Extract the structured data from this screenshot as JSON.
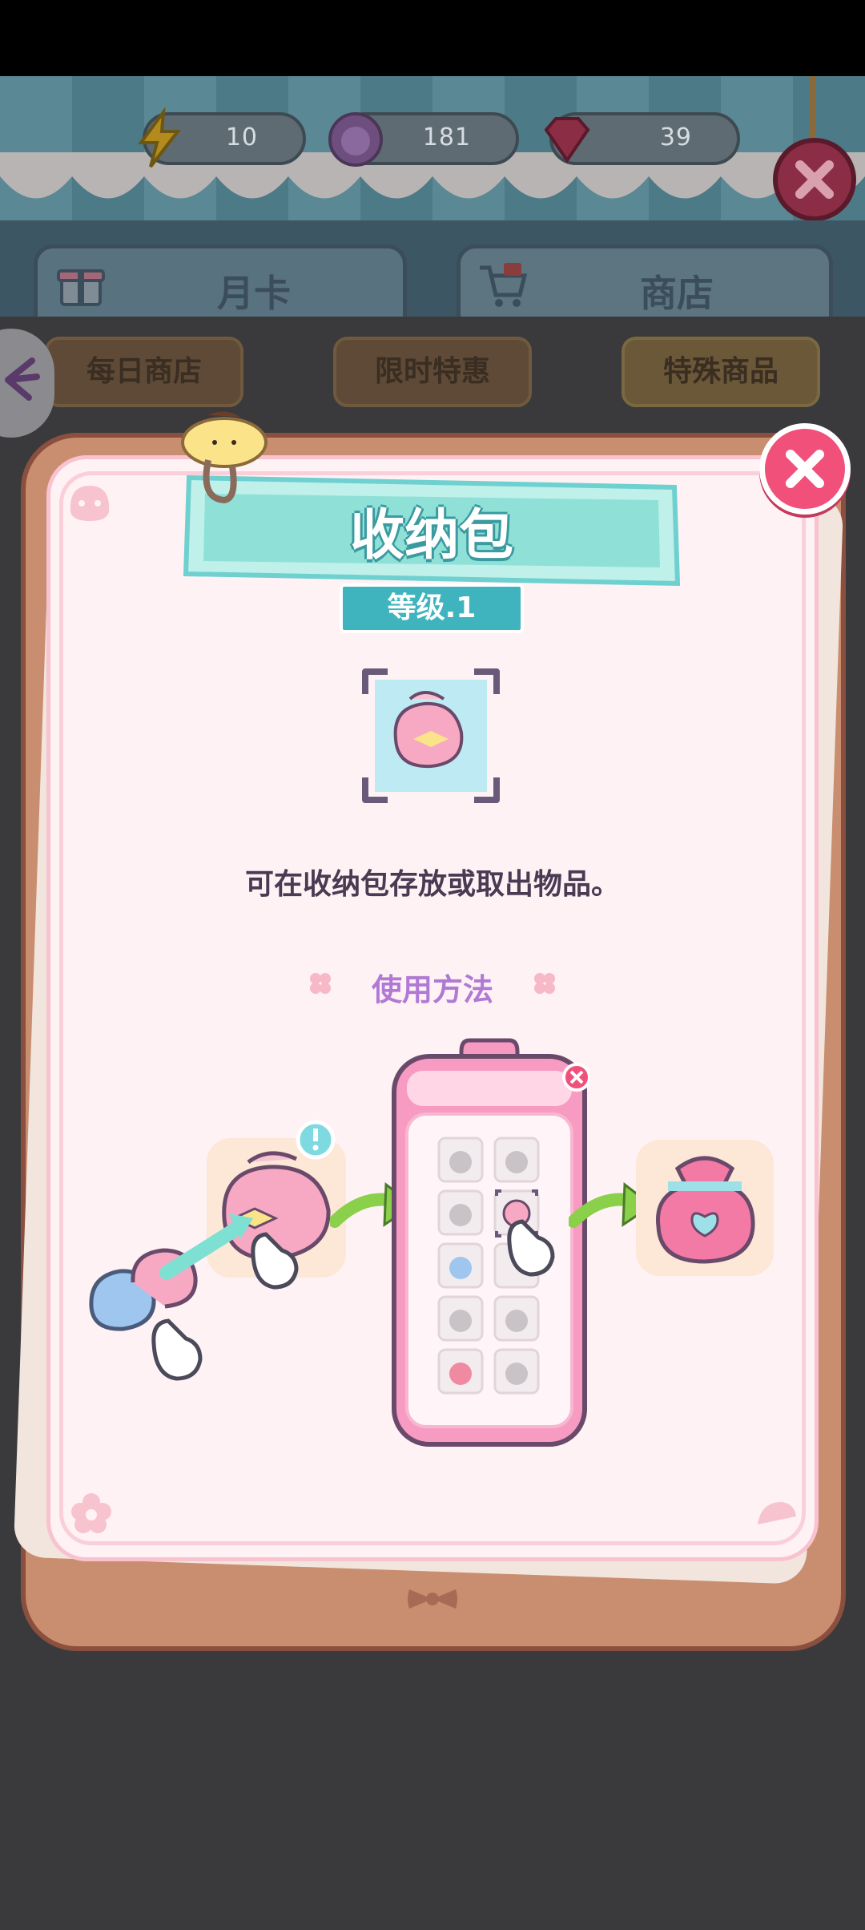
{
  "currencies": [
    {
      "icon": "lightning-icon",
      "value": "10"
    },
    {
      "icon": "kitty-coin-icon",
      "value": "181"
    },
    {
      "icon": "gem-icon",
      "value": "39"
    }
  ],
  "tabs": [
    {
      "icon": "gift-icon",
      "label": "月卡"
    },
    {
      "icon": "cart-icon",
      "label": "商店"
    }
  ],
  "shop_filters": [
    "每日商店",
    "限时特惠",
    "特殊商品"
  ],
  "modal": {
    "title": "收纳包",
    "level": "等级.1",
    "description": "可在收纳包存放或取出物品。",
    "howto_label": "使用方法"
  },
  "colors": {
    "accent_pink": "#f0507a",
    "teal": "#3fb4be",
    "howto_purple": "#b07ad4"
  }
}
